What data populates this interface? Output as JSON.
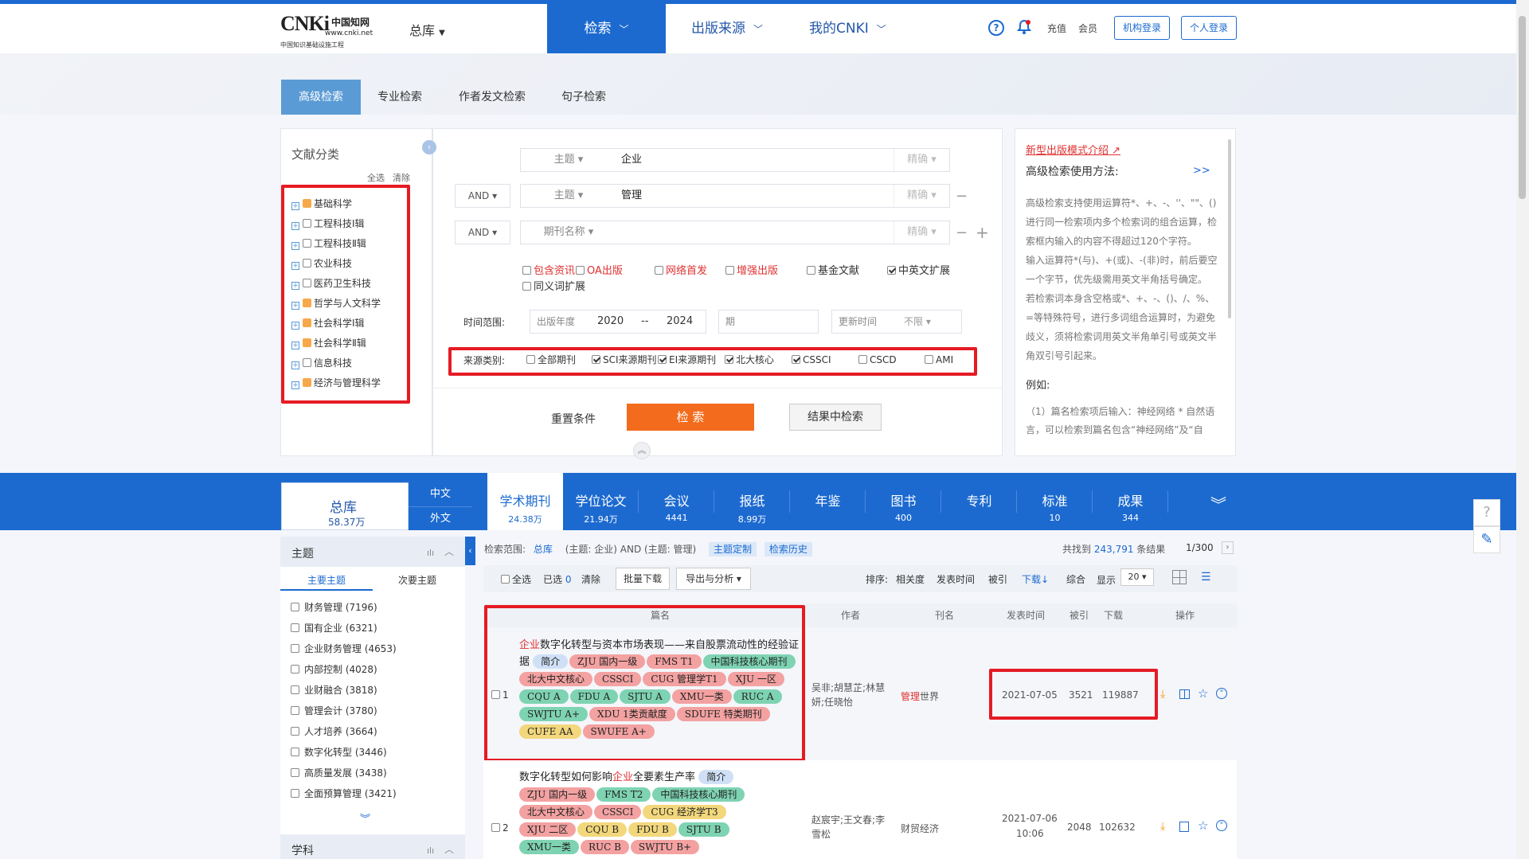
{
  "header": {
    "logo_big": "CNKi",
    "logo_cn": "中国知网",
    "logo_url": "www.cnki.net",
    "logo_sub": "中国知识基础设施工程",
    "db_select": "总库",
    "nav": [
      "检索",
      "出版来源",
      "我的CNKI"
    ],
    "recharge": "充值",
    "member": "会员",
    "org_login": "机构登录",
    "personal_login": "个人登录"
  },
  "search_tabs": [
    "高级检索",
    "专业检索",
    "作者发文检索",
    "句子检索"
  ],
  "classification": {
    "title": "文献分类",
    "select_all": "全选",
    "clear": "清除",
    "items": [
      {
        "label": "基础科学",
        "orange": true
      },
      {
        "label": "工程科技Ⅰ辑",
        "orange": false
      },
      {
        "label": "工程科技Ⅱ辑",
        "orange": false
      },
      {
        "label": "农业科技",
        "orange": false
      },
      {
        "label": "医药卫生科技",
        "orange": false
      },
      {
        "label": "哲学与人文科学",
        "orange": true
      },
      {
        "label": "社会科学Ⅰ辑",
        "orange": true
      },
      {
        "label": "社会科学Ⅱ辑",
        "orange": true
      },
      {
        "label": "信息科技",
        "orange": false
      },
      {
        "label": "经济与管理科学",
        "orange": true
      }
    ]
  },
  "query": {
    "rows": [
      {
        "op": "",
        "field": "主题 ▾",
        "value": "企业",
        "precision": "精确 ▾"
      },
      {
        "op": "AND ▾",
        "field": "主题 ▾",
        "value": "管理",
        "precision": "精确 ▾"
      },
      {
        "op": "AND ▾",
        "field": "期刊名称 ▾",
        "value": "",
        "precision": "精确 ▾"
      }
    ],
    "options": [
      {
        "label": "包含资讯",
        "red": true,
        "checked": false
      },
      {
        "label": "OA出版",
        "red": true,
        "checked": false
      },
      {
        "label": "网络首发",
        "red": true,
        "checked": false
      },
      {
        "label": "增强出版",
        "red": true,
        "checked": false
      },
      {
        "label": "基金文献",
        "red": false,
        "checked": false
      },
      {
        "label": "中英文扩展",
        "red": false,
        "checked": true
      }
    ],
    "synonym": "同义词扩展",
    "time_label": "时间范围:",
    "year_label": "出版年度",
    "year_from": "2020",
    "year_sep": "--",
    "year_to": "2024",
    "issue_label": "期",
    "update_label": "更新时间",
    "update_value": "不限 ▾",
    "source_label": "来源类别:",
    "sources": [
      {
        "label": "全部期刊",
        "checked": false
      },
      {
        "label": "SCI来源期刊",
        "checked": true
      },
      {
        "label": "EI来源期刊",
        "checked": true
      },
      {
        "label": "北大核心",
        "checked": true
      },
      {
        "label": "CSSCI",
        "checked": true
      },
      {
        "label": "CSCD",
        "checked": false
      },
      {
        "label": "AMI",
        "checked": false
      }
    ],
    "reset": "重置条件",
    "search": "检 索",
    "search_in": "结果中检索"
  },
  "help": {
    "link": "新型出版模式介绍",
    "title": "高级检索使用方法:",
    "more": ">>",
    "lines": [
      "高级检索支持使用运算符*、+、-、''、\"\"、()",
      "进行同一检索项内多个检索词的组合运算，检",
      "索框内输入的内容不得超过120个字符。",
      "输入运算符*(与)、+(或)、-(非)时，前后要空",
      "一个字节，优先级需用英文半角括号确定。",
      "若检索词本身含空格或*、+、-、()、/、%、",
      "=等特殊符号，进行多词组合运算时，为避免",
      "歧义，须将检索词用英文半角单引号或英文半",
      "角双引号引起来。"
    ],
    "example": "例如:",
    "ex_lines": [
      "（1）篇名检索项后输入：神经网络 * 自然语",
      "言，可以检索到篇名包含“神经网络”及“自"
    ]
  },
  "db_tabs": {
    "total_label": "总库",
    "total_count": "58.37万",
    "zh": "中文",
    "foreign": "外文",
    "tabs": [
      {
        "t": "学术期刊",
        "n": "24.38万"
      },
      {
        "t": "学位论文",
        "n": "21.94万"
      },
      {
        "t": "会议",
        "n": "4441"
      },
      {
        "t": "报纸",
        "n": "8.99万"
      },
      {
        "t": "年鉴",
        "n": ""
      },
      {
        "t": "图书",
        "n": "400"
      },
      {
        "t": "专利",
        "n": ""
      },
      {
        "t": "标准",
        "n": "10"
      },
      {
        "t": "成果",
        "n": "344"
      }
    ]
  },
  "facets": {
    "title": "主题",
    "sub_main": "主要主题",
    "sub_second": "次要主题",
    "items": [
      "财务管理 (7196)",
      "国有企业 (6321)",
      "企业财务管理 (4653)",
      "内部控制 (4028)",
      "业财融合 (3818)",
      "管理会计 (3780)",
      "人才培养 (3664)",
      "数字化转型 (3446)",
      "高质量发展 (3438)",
      "全面预算管理 (3421)"
    ],
    "title2": "学科"
  },
  "results_bar": {
    "scope_label": "检索范围:",
    "scope": "总库",
    "expr": "(主题: 企业) AND (主题: 管理)",
    "topic_custom": "主题定制",
    "history": "检索历史",
    "found_prefix": "共找到",
    "found": "243,791",
    "found_suffix": "条结果",
    "page": "1/300",
    "select_all": "全选",
    "selected": "已选",
    "selected_count": "0",
    "clear": "清除",
    "batch": "批量下载",
    "export": "导出与分析 ▾",
    "sort_label": "排序:",
    "sort": [
      "相关度",
      "发表时间",
      "被引",
      "下载↓",
      "综合"
    ],
    "show_label": "显示",
    "show_value": "20 ▾"
  },
  "table": {
    "headers": [
      "篇名",
      "作者",
      "刊名",
      "发表时间",
      "被引",
      "下载",
      "操作"
    ]
  },
  "rows": [
    {
      "num": "1",
      "kw": "企业",
      "title_rest": "数字化转型与资本市场表现——来自股票流动性的经验证据",
      "intro": "简介",
      "tags": [
        [
          "ZJU 国内一级",
          "tp"
        ],
        [
          "FMS T1",
          "tp"
        ],
        [
          "中国科技核心期刊",
          "tg"
        ],
        [
          "北大中文核心",
          "tp"
        ],
        [
          "CSSCI",
          "tp"
        ],
        [
          "CUG 管理学T1",
          "tp"
        ],
        [
          "XJU 一区",
          "tp"
        ],
        [
          "CQU A",
          "tg"
        ],
        [
          "FDU A",
          "tg"
        ],
        [
          "SJTU A",
          "tg"
        ],
        [
          "XMU一类",
          "tp"
        ],
        [
          "RUC A",
          "tg"
        ],
        [
          "SWJTU A+",
          "tg"
        ],
        [
          "XDU 1类贡献度",
          "tp"
        ],
        [
          "SDUFE 特类期刊",
          "tp"
        ],
        [
          "CUFE AA",
          "ty"
        ],
        [
          "SWUFE A+",
          "tp"
        ]
      ],
      "authors": "吴非;胡慧芷;林慧妍;任晓怡",
      "journal_kw": "管理",
      "journal_rest": "世界",
      "date": "2021-07-05",
      "cited": "3521",
      "downloads": "119887"
    },
    {
      "num": "2",
      "title_pre": "数字化转型如何影响",
      "kw": "企业",
      "title_rest": "全要素生产率",
      "intro": "简介",
      "tags": [
        [
          "ZJU 国内一级",
          "tp"
        ],
        [
          "FMS T2",
          "tg"
        ],
        [
          "中国科技核心期刊",
          "tg"
        ],
        [
          "北大中文核心",
          "tp"
        ],
        [
          "CSSCI",
          "tp"
        ],
        [
          "CUG 经济学T3",
          "ty"
        ],
        [
          "XJU 二区",
          "tp"
        ],
        [
          "CQU B",
          "ty"
        ],
        [
          "FDU B",
          "ty"
        ],
        [
          "SJTU B",
          "tg"
        ],
        [
          "XMU一类",
          "tg"
        ],
        [
          "RUC B",
          "tp"
        ],
        [
          "SWJTU B+",
          "tp"
        ]
      ],
      "authors": "赵宸宇;王文春;李雪松",
      "journal": "财贸经济",
      "date": "2021-07-06",
      "time": "10:06",
      "cited": "2048",
      "downloads": "102632"
    }
  ]
}
